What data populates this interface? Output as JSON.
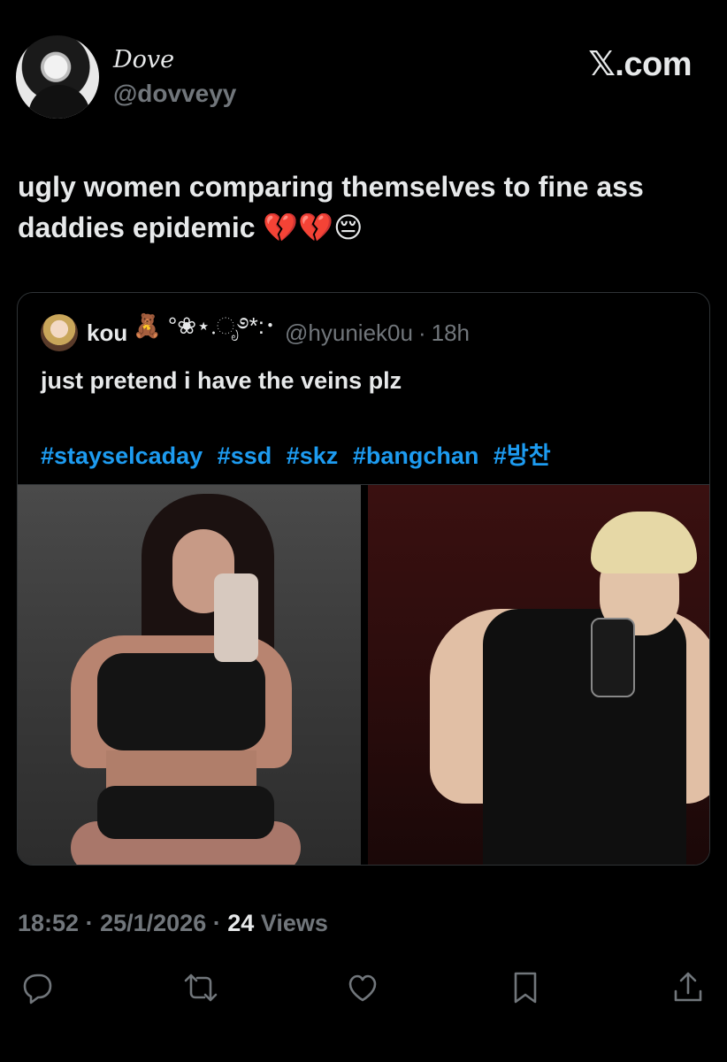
{
  "author": {
    "display_name": "Dove",
    "handle": "@dovveyy"
  },
  "brand": "𝕏.com",
  "tweet": {
    "text": "ugly women comparing themselves to fine ass daddies epidemic 💔💔😔"
  },
  "quoted": {
    "name": "kou",
    "decoration": "🧸 °❀⋆.ೃ࿔*:･",
    "handle": "@hyuniek0u",
    "separator": "·",
    "time": "18h",
    "text": "just pretend i have the veins plz",
    "hashtags": [
      "#stayselcaday",
      "#ssd",
      "#skz",
      "#bangchan",
      "#방찬"
    ]
  },
  "meta": {
    "time": "18:52",
    "date": "25/1/2026",
    "sep1": "·",
    "sep2": "·",
    "views_count": "24",
    "views_label": "Views"
  },
  "actions": [
    "reply-icon",
    "retweet-icon",
    "like-icon",
    "bookmark-icon",
    "share-icon"
  ],
  "colors": {
    "background": "#000000",
    "text": "#e7e9ea",
    "muted": "#71767b",
    "link": "#1d9bf0",
    "border": "#2f3336"
  }
}
